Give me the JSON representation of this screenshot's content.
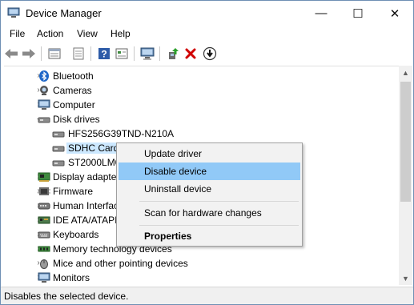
{
  "window": {
    "title": "Device Manager",
    "minimize": "—",
    "maximize": "☐",
    "close": "✕"
  },
  "menu": [
    "File",
    "Action",
    "View",
    "Help"
  ],
  "toolbar_icons": [
    "back-icon",
    "forward-icon",
    "properties-icon",
    "view-icon",
    "help-icon",
    "details-icon",
    "monitor-icon",
    "update-driver-icon",
    "uninstall-icon",
    "disable-icon"
  ],
  "tree": {
    "bluetooth": "Bluetooth",
    "cameras": "Cameras",
    "computer": "Computer",
    "disk_drives": "Disk drives",
    "disk1": "HFS256G39TND-N210A",
    "disk2": "SDHC Card",
    "disk3": "ST2000LM00",
    "display": "Display adapter",
    "firmware": "Firmware",
    "hid": "Human Interfac",
    "ide": "IDE ATA/ATAPI",
    "keyboards": "Keyboards",
    "memory": "Memory technology devices",
    "mice": "Mice and other pointing devices",
    "monitors": "Monitors"
  },
  "context_menu": {
    "update": "Update driver",
    "disable": "Disable device",
    "uninstall": "Uninstall device",
    "scan": "Scan for hardware changes",
    "properties": "Properties"
  },
  "status": "Disables the selected device.",
  "colors": {
    "highlight": "#91c9f7",
    "selection": "#cce8ff",
    "close_red": "#d00000"
  }
}
